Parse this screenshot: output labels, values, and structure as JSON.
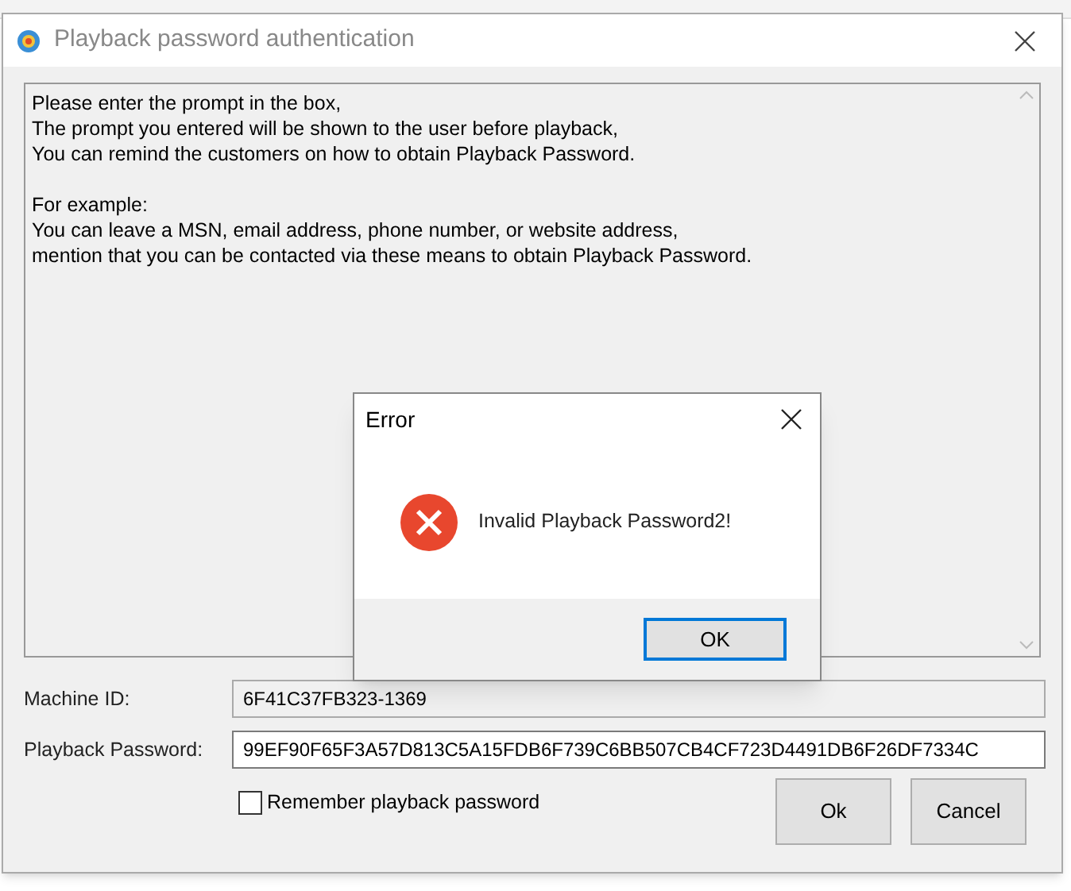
{
  "window": {
    "title": "Playback password authentication"
  },
  "prompt_paragraphs": [
    [
      "Please enter the prompt in the box,",
      "The prompt you entered will be shown to the user before playback,",
      "You can remind the customers on how to obtain Playback Password."
    ],
    [
      "For example:",
      "You can leave a MSN, email address, phone number, or website address,",
      "mention that you can be contacted via these means to obtain Playback Password."
    ]
  ],
  "fields": [
    {
      "label": "Machine ID:",
      "value": "6F41C37FB323-1369",
      "disabled": true
    },
    {
      "label": "Playback Password:",
      "value": "99EF90F65F3A57D813C5A15FDB6F739C6BB507CB4CF723D4491DB6F26DF7334C",
      "disabled": false
    }
  ],
  "remember": {
    "label": "Remember playback password",
    "checked": false
  },
  "buttons": [
    "Ok",
    "Cancel"
  ],
  "error_dialog": {
    "title": "Error",
    "message": "Invalid Playback Password2!",
    "button": "OK"
  }
}
